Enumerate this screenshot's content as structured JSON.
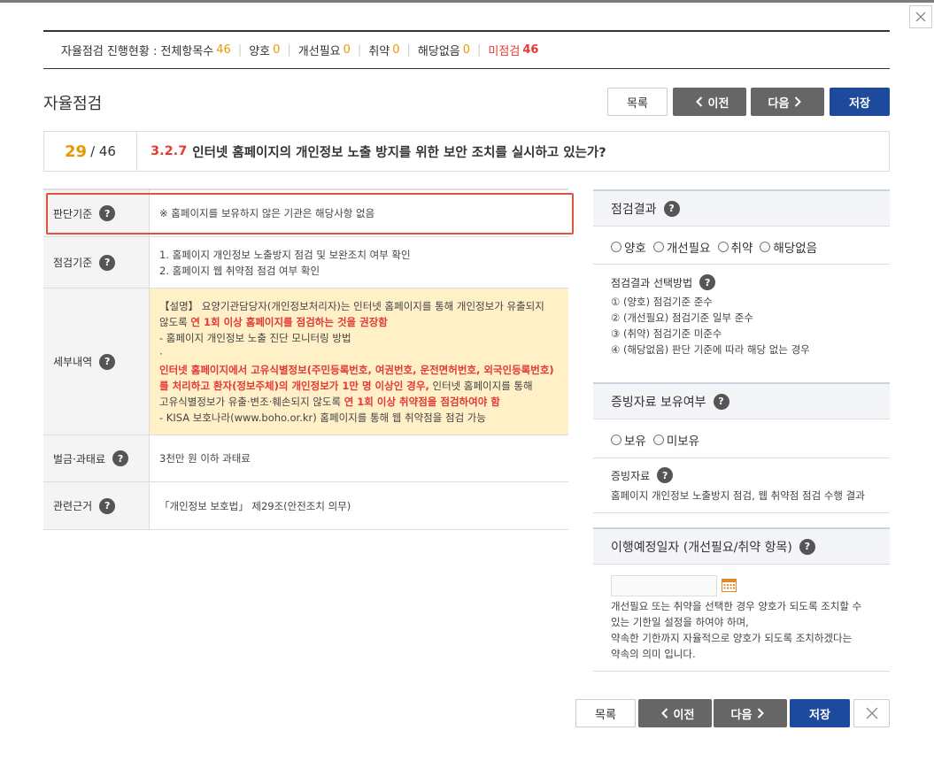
{
  "status": {
    "label": "자율점검 진행현황 : 전체항목수",
    "total": "46",
    "items": [
      {
        "label": "양호",
        "value": "0"
      },
      {
        "label": "개선필요",
        "value": "0"
      },
      {
        "label": "취약",
        "value": "0"
      },
      {
        "label": "해당없음",
        "value": "0"
      }
    ],
    "unchecked": {
      "label": "미점검",
      "value": "46"
    }
  },
  "page_title": "자율점검",
  "buttons": {
    "list": "목록",
    "prev": "이전",
    "next": "다음",
    "save": "저장"
  },
  "question": {
    "current": "29",
    "total": "/ 46",
    "code": "3.2.7",
    "text": "인터넷 홈페이지의 개인정보 노출 방지를 위한 보안 조치를 실시하고 있는가?"
  },
  "rows": {
    "criteria": {
      "head": "판단기준",
      "text": "※ 홈페이지를 보유하지 않은 기관은 해당사항 없음"
    },
    "check": {
      "head": "점검기준",
      "lines": [
        "1. 홈페이지 개인정보 노출방지 점검 및 보완조치 여부 확인",
        "2. 홈페이지 웹 취약점 점검 여부 확인"
      ]
    },
    "detail": {
      "head": "세부내역",
      "l1": "【설명】 요양기관담당자(개인정보처리자)는 인터넷 홈페이지를 통해 개인정보가 유출되지",
      "l2a": "않도록 ",
      "l2b": "연 1회 이상 홈페이지를 점검하는 것을 권장함",
      "l3": "- 홈페이지 개인정보 노출 진단 모니터링 방법",
      "l4": "·",
      "l5": "인터넷 홈페이지에서 고유식별정보(주민등록번호, 여권번호, 운전면허번호, 외국인등록번호)",
      "l6a": "를 처리하고 환자(정보주체)의 개인정보가 1만 명 이상인 경우,",
      "l6b": " 인터넷 홈페이지를 통해",
      "l7a": "고유식별정보가 유출·변조·훼손되지 않도록 ",
      "l7b": "연 1회 이상 취약점을 점검하여야 함",
      "l8": "- KISA 보호나라(www.boho.or.kr) 홈페이지를 통해 웹 취약점을 점검 가능"
    },
    "fine": {
      "head": "벌금·과태료",
      "text": "3천만 원 이하 과태료"
    },
    "basis": {
      "head": "관련근거",
      "text": "「개인정보 보호법」 제29조(안전조치 의무)"
    }
  },
  "right": {
    "result_title": "점검결과",
    "result_options": [
      "양호",
      "개선필요",
      "취약",
      "해당없음"
    ],
    "method_title": "점검결과 선택방법",
    "method_lines": [
      "① (양호) 점검기준 준수",
      "② (개선필요) 점검기준 일부 준수",
      "③ (취약) 점검기준 미준수",
      "④ (해당없음) 판단 기준에 따라 해당 없는 경우"
    ],
    "evidence_title": "증빙자료 보유여부",
    "evidence_options": [
      "보유",
      "미보유"
    ],
    "evidence_sub_title": "증빙자료",
    "evidence_text": "홈페이지 개인정보 노출방지 점검, 웹 취약점 점검 수행 결과",
    "plan_title": "이행예정일자 (개선필요/취약 항목)",
    "plan_lines": [
      "개선필요 또는 취약을 선택한 경우 양호가 되도록 조치할 수",
      "있는 기한일 설정을 하여야 하며,",
      "약속한 기한까지 자율적으로 양호가 되도록 조치하겠다는",
      "약속의 의미 입니다."
    ]
  },
  "help_symbol": "?"
}
